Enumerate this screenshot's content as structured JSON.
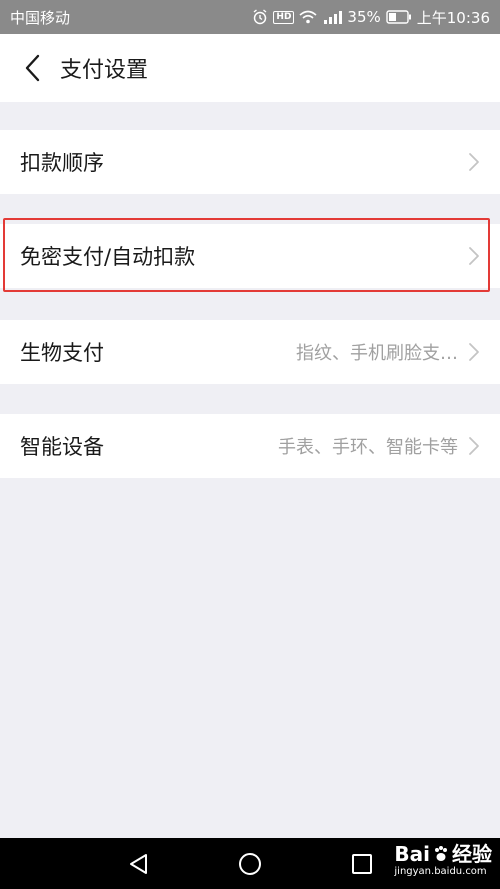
{
  "status_bar": {
    "carrier": "中国移动",
    "hd": "HD",
    "battery": "35%",
    "time": "上午10:36"
  },
  "header": {
    "title": "支付设置"
  },
  "rows": [
    {
      "label": "扣款顺序",
      "value": ""
    },
    {
      "label": "免密支付/自动扣款",
      "value": ""
    },
    {
      "label": "生物支付",
      "value": "指纹、手机刷脸支…"
    },
    {
      "label": "智能设备",
      "value": "手表、手环、智能卡等"
    }
  ],
  "watermark": {
    "brand": "Bai",
    "brand_suffix": "经验",
    "url": "jingyan.baidu.com"
  },
  "colors": {
    "highlight": "#e33a36",
    "background": "#efeff4",
    "status_bar": "#8a8a8a"
  }
}
